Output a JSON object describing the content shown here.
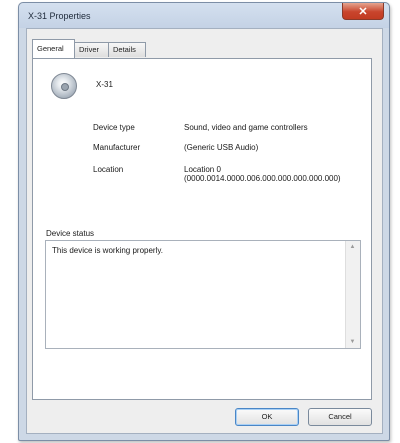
{
  "window": {
    "title": "X-31 Properties",
    "close_symbol": "✕"
  },
  "tabs": [
    {
      "label": "General",
      "active": true
    },
    {
      "label": "Driver",
      "active": false
    },
    {
      "label": "Details",
      "active": false
    }
  ],
  "general": {
    "device_name": "X-31",
    "device_icon": "speaker-icon",
    "properties": [
      {
        "label": "Device type",
        "value": "Sound, video and game controllers"
      },
      {
        "label": "Manufacturer",
        "value": "(Generic USB Audio)"
      },
      {
        "label": "Location",
        "value": "Location 0",
        "value2": "(0000.0014.0000.006.000.000.000.000.000)"
      }
    ],
    "status_group_label": "Device status",
    "status_text": "This device is working properly."
  },
  "buttons": {
    "ok": "OK",
    "cancel": "Cancel"
  },
  "colors": {
    "title_bar": "#cdd8e6",
    "close_button": "#c9452d",
    "dialog_body": "#eeeeee"
  }
}
